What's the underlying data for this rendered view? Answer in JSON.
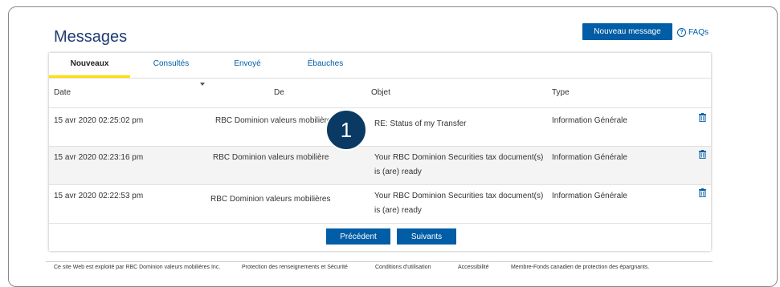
{
  "header": {
    "title": "Messages",
    "new_message_label": "Nouveau message",
    "faq_label": "FAQs"
  },
  "tabs": [
    {
      "label": "Nouveaux",
      "active": true
    },
    {
      "label": "Consultés",
      "active": false
    },
    {
      "label": "Envoyé",
      "active": false
    },
    {
      "label": "Ébauches",
      "active": false
    }
  ],
  "table": {
    "columns": [
      "Date",
      "De",
      "Objet",
      "Type"
    ],
    "rows": [
      {
        "date": "15 avr 2020 02:25:02 pm",
        "from": "RBC Dominion valeurs mobilières",
        "subject_line1": "RE: Status of my Transfer",
        "subject_line2": "",
        "type": "Information Générale"
      },
      {
        "date": "15 avr 2020 02:23:16 pm",
        "from": "RBC Dominion valeurs mobilière",
        "subject_line1": "Your RBC Dominion Securities tax document(s)",
        "subject_line2": "is (are) ready",
        "type": "Information Générale"
      },
      {
        "date": "15 avr 2020 02:22:53 pm",
        "from": "RBC Dominion valeurs mobilières",
        "subject_line1": "Your RBC Dominion Securities tax document(s)",
        "subject_line2": "is (are) ready",
        "type": "Information Générale"
      }
    ]
  },
  "pagination": {
    "prev_label": "Précédent",
    "next_label": "Suivants"
  },
  "callout": {
    "number": "1"
  },
  "footer": {
    "operator": "Ce site Web est exploité par RBC Dominion valeurs mobilières Inc.",
    "links": [
      "Protection des renseignements et Sécurité",
      "Conditions d'utilisation",
      "Accessibilité",
      "Membre-Fonds canadien de protection des épargnants."
    ]
  },
  "colors": {
    "brand_blue": "#005da6",
    "title_blue": "#1f3b73",
    "tab_underline": "#fedf01",
    "callout": "#0a3a64"
  }
}
